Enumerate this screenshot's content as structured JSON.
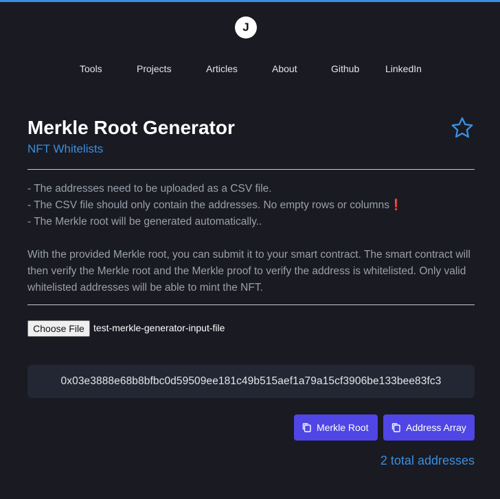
{
  "header": {
    "logo_letter": "J"
  },
  "nav": {
    "items": [
      "Tools",
      "Projects",
      "Articles",
      "About",
      "Github",
      "LinkedIn"
    ]
  },
  "page": {
    "title": "Merkle Root Generator",
    "subtitle": "NFT Whitelists"
  },
  "description": {
    "bullets": [
      "- The addresses need to be uploaded as a CSV file.",
      "- The CSV file should only contain the addresses. No empty rows or columns❗",
      "- The Merkle root will be generated automatically.."
    ],
    "paragraph": "With the provided Merkle root, you can submit it to your smart contract. The smart contract will then verify the Merkle root and the Merkle proof to verify the address is whitelisted. Only valid whitelisted addresses will be able to mint the NFT."
  },
  "file_input": {
    "button_label": "Choose File",
    "file_name": "test-merkle-generator-input-file"
  },
  "merkle_root": "0x03e3888e68b8bfbc0d59509ee181c49b515aef1a79a15cf3906be133bee83fc3",
  "actions": {
    "merkle_root_label": "Merkle Root",
    "address_array_label": "Address Array"
  },
  "total_addresses": "2 total addresses",
  "colors": {
    "background": "#191a22",
    "accent": "#3b8ee0",
    "button": "#4f46e5"
  }
}
